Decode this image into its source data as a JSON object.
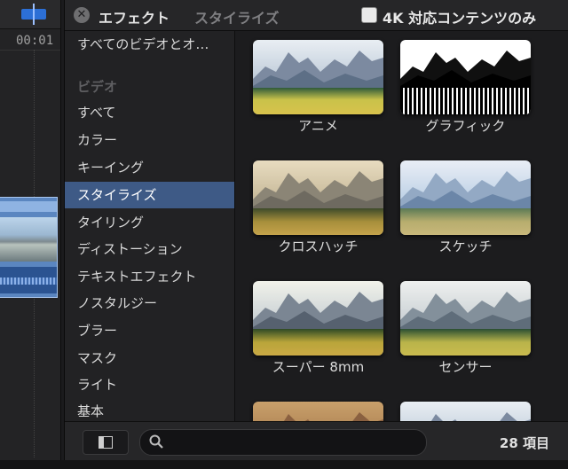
{
  "timeline": {
    "timecode": "00:01"
  },
  "header": {
    "title": "エフェクト",
    "breadcrumb": "スタイライズ",
    "checkbox_label": "4K 対応コンテンツのみ"
  },
  "sidebar": {
    "top_item": "すべてのビデオとオ…",
    "section_video": "ビデオ",
    "items": [
      "すべて",
      "カラー",
      "キーイング",
      "スタイライズ",
      "タイリング",
      "ディストーション",
      "テキストエフェクト",
      "ノスタルジー",
      "ブラー",
      "マスク",
      "ライト",
      "基本"
    ],
    "selected": "スタイライズ"
  },
  "effects": [
    {
      "label": "アニメ",
      "style": "anime"
    },
    {
      "label": "グラフィック",
      "style": "graphic"
    },
    {
      "label": "クロスハッチ",
      "style": "crosshatch"
    },
    {
      "label": "スケッチ",
      "style": "sketch"
    },
    {
      "label": "スーパー 8mm",
      "style": "super8"
    },
    {
      "label": "センサー",
      "style": "sensor"
    },
    {
      "label": "",
      "style": "warm"
    },
    {
      "label": "",
      "style": "plain"
    }
  ],
  "footer": {
    "search_placeholder": "",
    "item_count": "28 項目"
  },
  "icons": {
    "close": "close-icon",
    "sidebar_toggle": "sidebar-toggle-icon",
    "search": "search-icon"
  }
}
